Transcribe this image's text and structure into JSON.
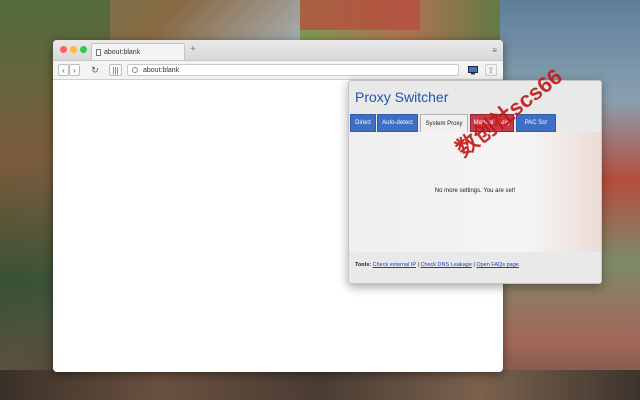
{
  "browser": {
    "tab_title": "about:blank",
    "new_tab_symbol": "+",
    "menu_symbol": "≡",
    "nav": {
      "back": "‹",
      "forward": "›",
      "reload": "↻",
      "grid": "|||"
    },
    "url": "about:blank"
  },
  "popup": {
    "title": "Proxy Switcher",
    "tabs": [
      {
        "label": "Direct"
      },
      {
        "label": "Auto-detect"
      },
      {
        "label": "System Proxy"
      },
      {
        "label": "Manual Proxy"
      },
      {
        "label": "PAC Scr"
      }
    ],
    "active_tab": "System Proxy",
    "message": "No more settings. You are set!",
    "tools": {
      "label": "Tools:",
      "link1": "Check external IP",
      "sep": "|",
      "link2": "Check DNS Leakage",
      "link3": "Open FAQs page"
    }
  },
  "watermark": "数创社scs66",
  "colors": {
    "title_blue": "#2255aa",
    "tab_blue": "#3f6fc2",
    "tab_red": "#c83a4a",
    "link": "#1a3cc7"
  }
}
